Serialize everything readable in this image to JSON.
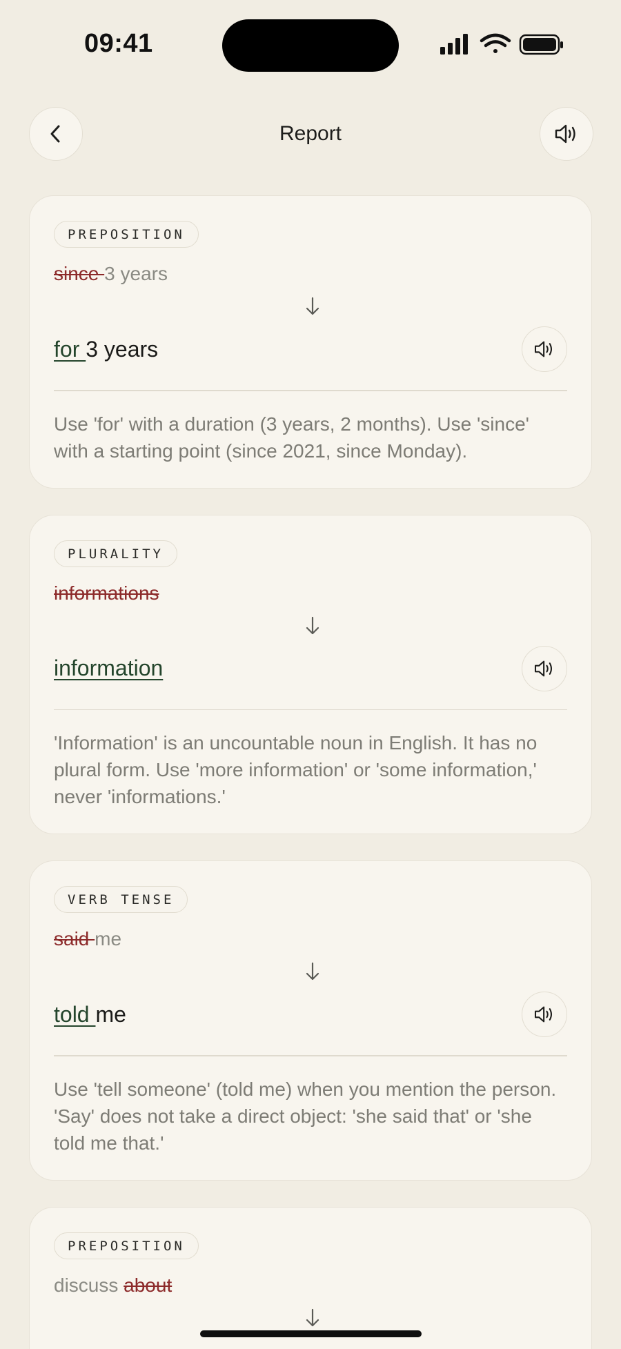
{
  "status_bar": {
    "time": "09:41"
  },
  "header": {
    "title": "Report"
  },
  "cards": [
    {
      "tag": "PREPOSITION",
      "original_wrong": "since ",
      "original_rest": "3 years",
      "fix": "for ",
      "fix_rest": "3 years",
      "explanation": "Use 'for' with a duration (3 years, 2 months). Use 'since' with a starting point (since 2021, since Monday)."
    },
    {
      "tag": "PLURALITY",
      "original_wrong": "informations",
      "original_rest": "",
      "fix": "information",
      "fix_rest": "",
      "explanation": "'Information' is an uncountable noun in English. It has no plural form. Use 'more information' or 'some information,' never 'informations.'"
    },
    {
      "tag": "VERB TENSE",
      "original_wrong": "said ",
      "original_rest": "me",
      "fix": "told ",
      "fix_rest": "me",
      "explanation": "Use 'tell someone' (told me) when you mention the person. 'Say' does not take a direct object: 'she said that' or 'she told me that.'"
    },
    {
      "tag": "PREPOSITION",
      "original_prefix": "discuss ",
      "original_wrong": "about"
    }
  ],
  "icons": {
    "back": "chevron-left-icon",
    "sound": "speaker-icon",
    "arrow": "arrow-down-icon"
  },
  "colors": {
    "background": "#f1ede3",
    "card": "#f8f5ee",
    "wrong": "#8c2a2a",
    "fix": "#24452c",
    "muted": "#7d7c75"
  }
}
